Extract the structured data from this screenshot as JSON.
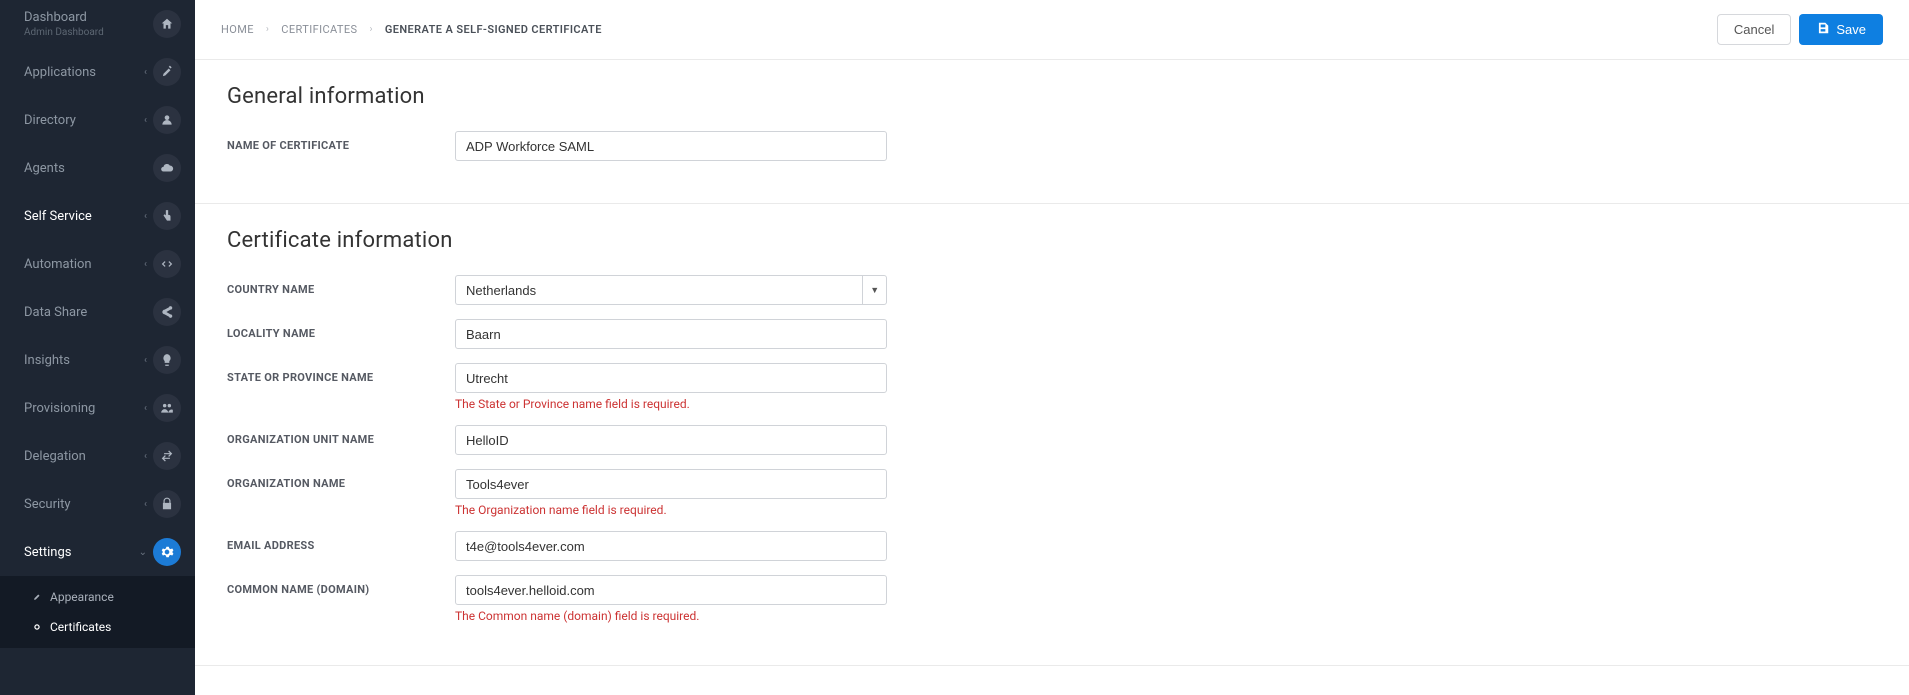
{
  "sidebar": {
    "items": [
      {
        "label": "Dashboard",
        "subtitle": "Admin Dashboard",
        "icon": "home-icon",
        "expandable": false
      },
      {
        "label": "Applications",
        "icon": "rocket-icon",
        "expandable": true
      },
      {
        "label": "Directory",
        "icon": "users-icon",
        "expandable": true
      },
      {
        "label": "Agents",
        "icon": "cloud-icon",
        "expandable": false
      },
      {
        "label": "Self Service",
        "icon": "pointer-icon",
        "expandable": true,
        "active": true
      },
      {
        "label": "Automation",
        "icon": "code-icon",
        "expandable": true
      },
      {
        "label": "Data Share",
        "icon": "share-icon",
        "expandable": false
      },
      {
        "label": "Insights",
        "icon": "bulb-icon",
        "expandable": true
      },
      {
        "label": "Provisioning",
        "icon": "group-icon",
        "expandable": true
      },
      {
        "label": "Delegation",
        "icon": "exchange-icon",
        "expandable": true
      },
      {
        "label": "Security",
        "icon": "lock-icon",
        "expandable": true
      },
      {
        "label": "Settings",
        "icon": "gear-icon",
        "expandable": true,
        "active": true,
        "open": true,
        "highlight": true
      }
    ],
    "settings_children": [
      {
        "label": "Appearance",
        "icon": "brush-icon"
      },
      {
        "label": "Certificates",
        "icon": "ring-icon",
        "active": true
      }
    ]
  },
  "breadcrumb": [
    {
      "label": "HOME"
    },
    {
      "label": "CERTIFICATES"
    },
    {
      "label": "GENERATE A SELF-SIGNED CERTIFICATE",
      "current": true
    }
  ],
  "actions": {
    "cancel": "Cancel",
    "save": "Save"
  },
  "general": {
    "title": "General information",
    "name_label": "NAME OF CERTIFICATE",
    "name_value": "ADP Workforce SAML"
  },
  "cert": {
    "title": "Certificate information",
    "country_label": "COUNTRY NAME",
    "country_value": "Netherlands",
    "locality_label": "LOCALITY NAME",
    "locality_value": "Baarn",
    "state_label": "STATE OR PROVINCE NAME",
    "state_value": "Utrecht",
    "state_error": "The State or Province name field is required.",
    "orgunit_label": "ORGANIZATION UNIT NAME",
    "orgunit_value": "HelloID",
    "org_label": "ORGANIZATION NAME",
    "org_value": "Tools4ever",
    "org_error": "The Organization name field is required.",
    "email_label": "EMAIL ADDRESS",
    "email_value": "t4e@tools4ever.com",
    "common_label": "COMMON NAME (DOMAIN)",
    "common_value": "tools4ever.helloid.com",
    "common_error": "The Common name (domain) field is required."
  }
}
